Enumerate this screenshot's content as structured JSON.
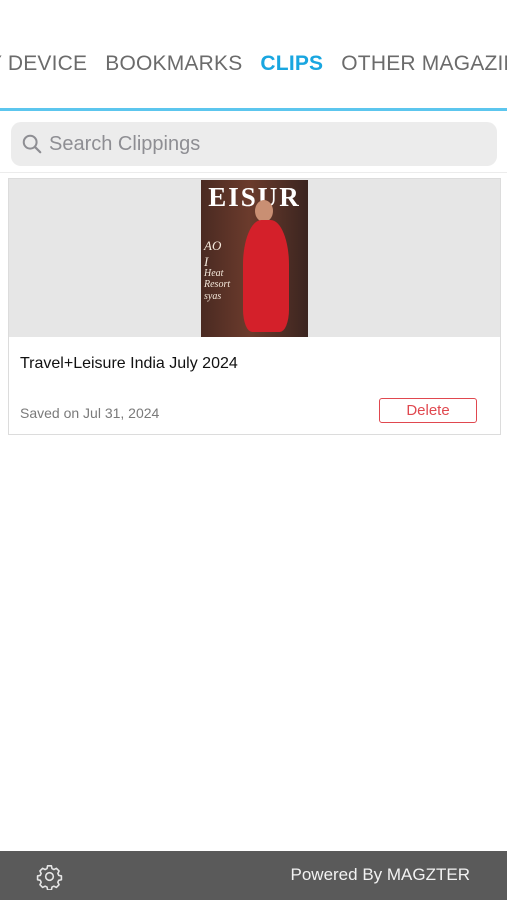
{
  "tabs": {
    "items": [
      {
        "label": "Y DEVICE"
      },
      {
        "label": "BOOKMARKS"
      },
      {
        "label": "CLIPS"
      },
      {
        "label": "OTHER MAGAZINES"
      }
    ],
    "active_index": 2,
    "active_color": "#19a6e0"
  },
  "search": {
    "placeholder": "Search Clippings",
    "value": ""
  },
  "clips": [
    {
      "cover_masthead": "EISUR",
      "cover_lines": [
        "AO",
        "I",
        "Heat",
        "Resort",
        "syas"
      ],
      "title": "Travel+Leisure India July 2024",
      "saved": "Saved on Jul 31, 2024",
      "delete_label": "Delete"
    }
  ],
  "footer": {
    "powered_by": "Powered By MAGZTER",
    "settings_icon": "gear-icon"
  },
  "colors": {
    "delete": "#e0484f",
    "footer_bg": "#5a5a5a",
    "tab_active": "#19a6e0"
  }
}
